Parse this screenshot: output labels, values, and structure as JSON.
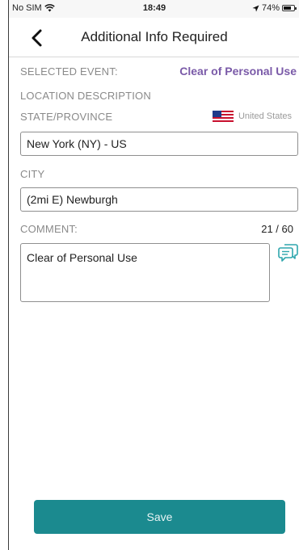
{
  "status_bar": {
    "carrier": "No SIM",
    "time": "18:49",
    "battery_percent": "74%",
    "battery_level": 0.74
  },
  "header": {
    "title": "Additional Info Required"
  },
  "form": {
    "selected_event_label": "SELECTED EVENT:",
    "selected_event_value": "Clear of Personal Use",
    "location_description_label": "LOCATION DESCRIPTION",
    "state_label": "STATE/PROVINCE",
    "country_name": "United States",
    "state_value": "New York (NY) - US",
    "city_label": "CITY",
    "city_value": "(2mi E) Newburgh",
    "comment_label": "COMMENT:",
    "comment_counter": "21 / 60",
    "comment_value": "Clear of Personal Use"
  },
  "actions": {
    "save_label": "Save"
  },
  "colors": {
    "accent": "#1b8a8f",
    "event_value": "#7a5aa8"
  },
  "icons": {
    "back": "chevron-left-icon",
    "wifi": "wifi-icon",
    "location": "location-arrow-icon",
    "battery": "battery-icon",
    "flag": "us-flag-icon",
    "comments": "comments-icon"
  }
}
